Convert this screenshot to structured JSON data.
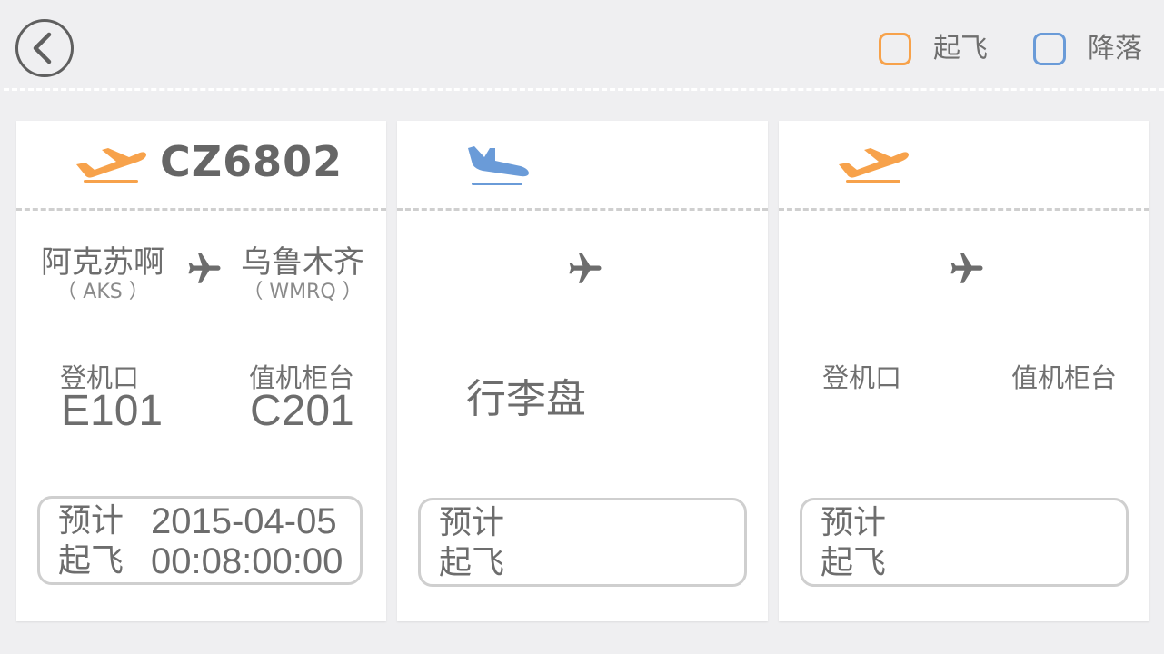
{
  "header": {
    "back_icon": "chevron-left-icon",
    "legend": [
      {
        "label": "起飞",
        "color": "#f7a24b"
      },
      {
        "label": "降落",
        "color": "#6a9bd8"
      }
    ]
  },
  "cards": [
    {
      "type": "takeoff",
      "icon": "takeoff-plane-icon",
      "flight_no": "CZ6802",
      "from_city": "阿克苏啊",
      "from_code": "（ AKS ）",
      "to_city": "乌鲁木齐",
      "to_code": "（ WMRQ ）",
      "gate_label": "登机口",
      "gate_value": "E101",
      "counter_label": "值机柜台",
      "counter_value": "C201",
      "sched_label_1": "预计",
      "sched_label_2": "起飞",
      "sched_date": "2015-04-05",
      "sched_time": "00:08:00:00"
    },
    {
      "type": "landing",
      "icon": "landing-plane-icon",
      "baggage_label": "行李盘",
      "sched_label_1": "预计",
      "sched_label_2": "起飞"
    },
    {
      "type": "takeoff",
      "icon": "takeoff-plane-icon",
      "gate_label": "登机口",
      "counter_label": "值机柜台",
      "sched_label_1": "预计",
      "sched_label_2": "起飞"
    }
  ],
  "colors": {
    "takeoff": "#f7a24b",
    "landing": "#6a9bd8",
    "text": "#6d6d6d",
    "background": "#efeff1"
  }
}
